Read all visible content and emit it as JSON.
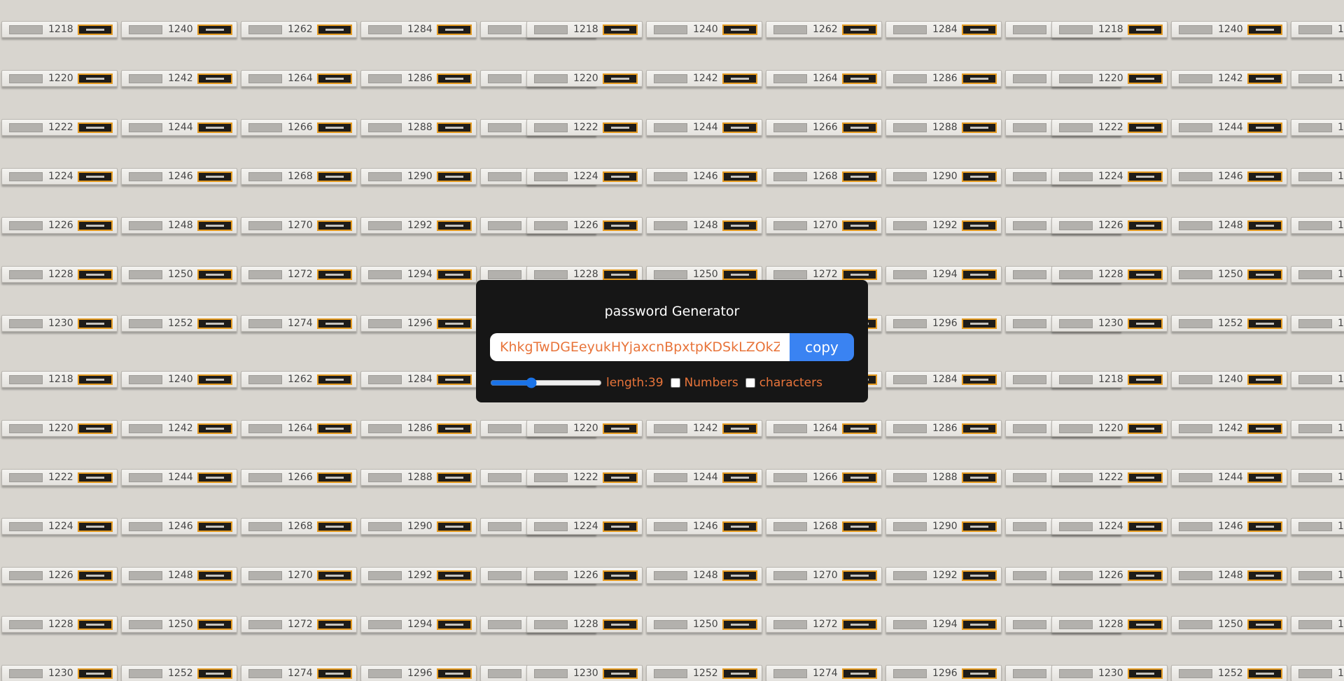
{
  "app": {
    "title": "password Generator"
  },
  "password": {
    "value": "KhkgTwDGEeyukHYjaxcnBpxtpKDSkLZOkZhcq",
    "copy_label": "copy"
  },
  "options": {
    "length_label": "length:39",
    "length_value": 39,
    "length_min": 6,
    "length_max": 100,
    "numbers_label": "Numbers",
    "numbers_checked": false,
    "characters_label": "characters",
    "characters_checked": false
  },
  "background": {
    "mailbox_numbers": [
      [
        "1218",
        "1240",
        "1262",
        "1284"
      ],
      [
        "1220",
        "1242",
        "1264",
        "1286"
      ],
      [
        "1222",
        "1244",
        "1266",
        "1288"
      ],
      [
        "1224",
        "1246",
        "1268",
        "1290"
      ],
      [
        "1226",
        "1248",
        "1270",
        "1292"
      ],
      [
        "1228",
        "1250",
        "1272",
        "1294"
      ],
      [
        "1230",
        "1252",
        "1274",
        "1296"
      ]
    ]
  },
  "colors": {
    "card_bg": "#161616",
    "accent": "#3a83f2",
    "orange_text": "#e8743a"
  }
}
